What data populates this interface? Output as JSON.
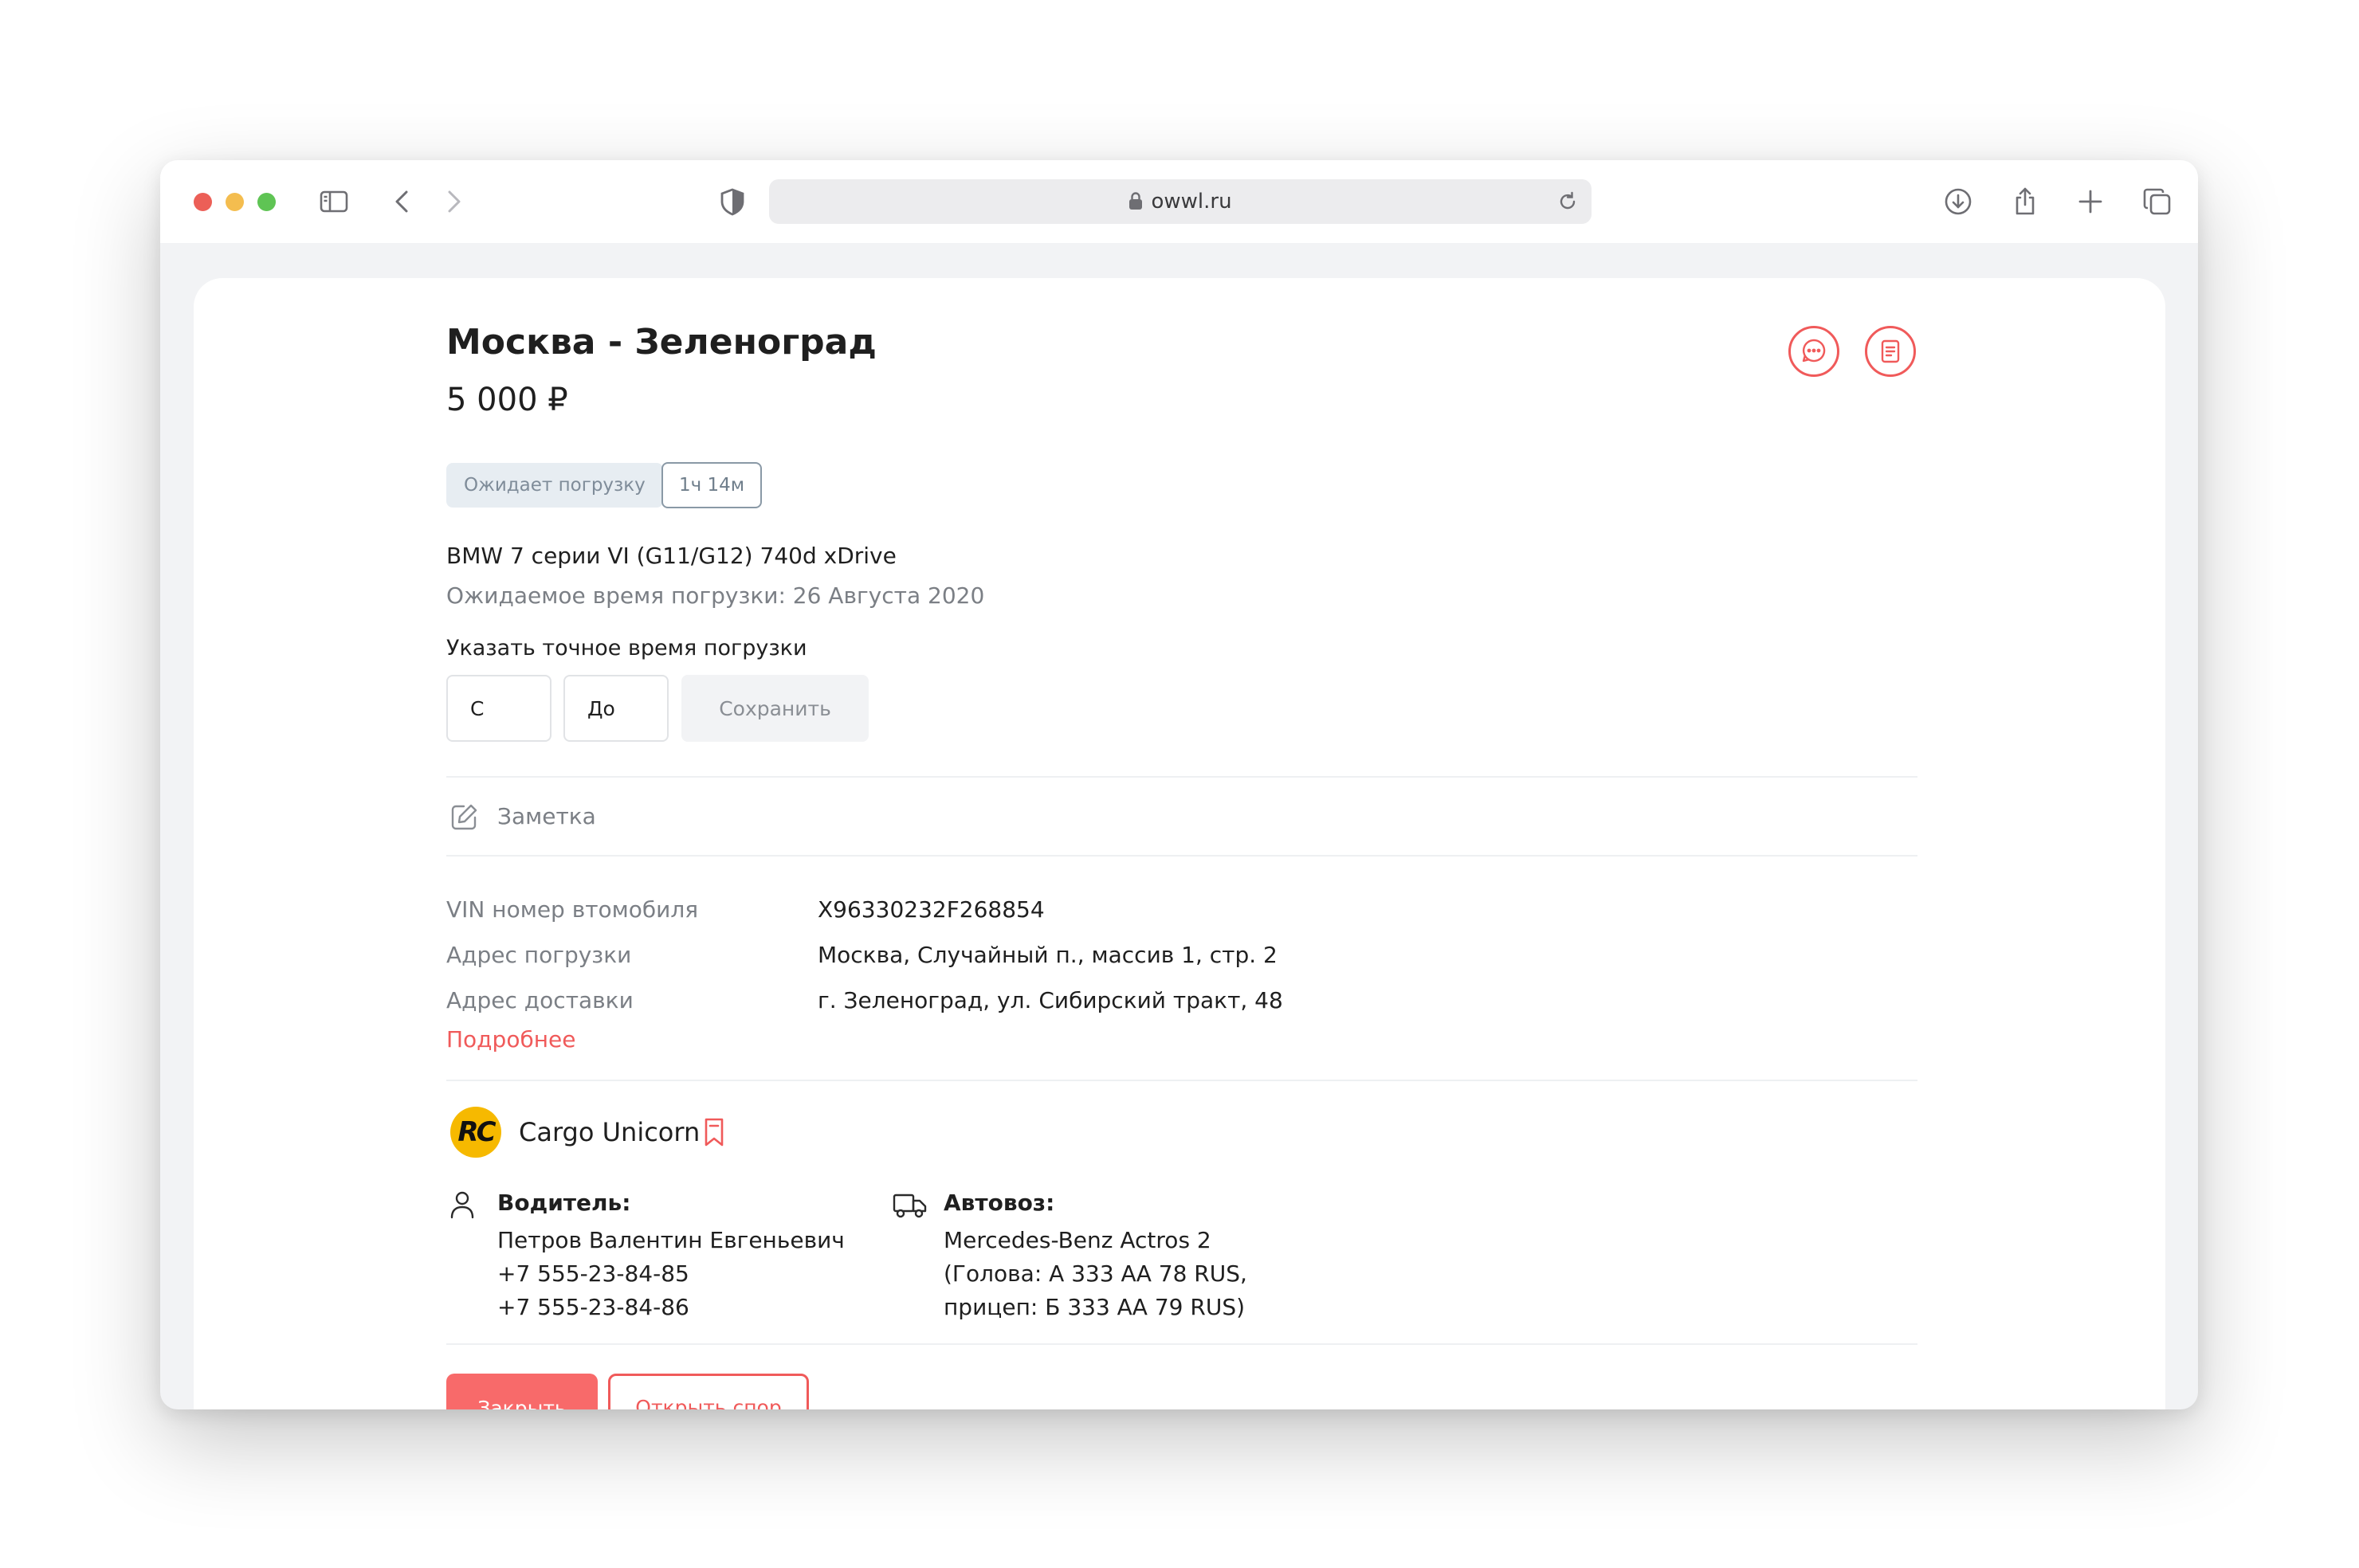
{
  "browser": {
    "url": "owwl.ru",
    "icons": [
      "sidebar-icon",
      "back-icon",
      "forward-icon",
      "shield-icon",
      "lock-icon",
      "reload-icon",
      "download-icon",
      "share-icon",
      "plus-icon",
      "tabs-icon"
    ]
  },
  "order": {
    "title": "Москва - Зеленоград",
    "price": "5 000 ₽",
    "status": "Ожидает погрузку",
    "timer": "1ч 14м",
    "car": "BMW 7 серии VI (G11/G12) 740d xDrive",
    "eta": "Ожидаемое время погрузки: 26 Августа 2020",
    "set_time_label": "Указать точное время погрузки",
    "from_placeholder": "С",
    "to_placeholder": "До",
    "save_label": "Сохранить",
    "note_label": "Заметка",
    "details": [
      {
        "label": "VIN номер втомобиля",
        "value": "X96330232F268854"
      },
      {
        "label": "Адрес погрузки",
        "value": "Москва, Случайный п., массив 1, стр. 2"
      },
      {
        "label": "Адрес доставки",
        "value": "г. Зеленоград, ул. Сибирский тракт, 48"
      }
    ],
    "more_link": "Подробнее"
  },
  "carrier": {
    "logo_text": "RC",
    "name": "Cargo Unicorn",
    "driver": {
      "title": "Водитель:",
      "name": "Петров Валентин Евгеньевич",
      "phones": [
        "+7 555-23-84-85",
        "+7 555-23-84-86"
      ]
    },
    "truck": {
      "title": "Автовоз:",
      "lines": [
        "Mercedes-Benz Actros 2",
        "(Голова: А 333 АА 78 RUS,",
        "прицеп: Б 333 АА 79 RUS)"
      ]
    }
  },
  "actions": {
    "close_label": "Закрыть",
    "dispute_label": "Открыть спор"
  },
  "colors": {
    "accent": "#f05a5a",
    "accent_fill": "#f86a6a",
    "status_bg": "#e7edf2",
    "logo_yellow": "#f6b900"
  }
}
